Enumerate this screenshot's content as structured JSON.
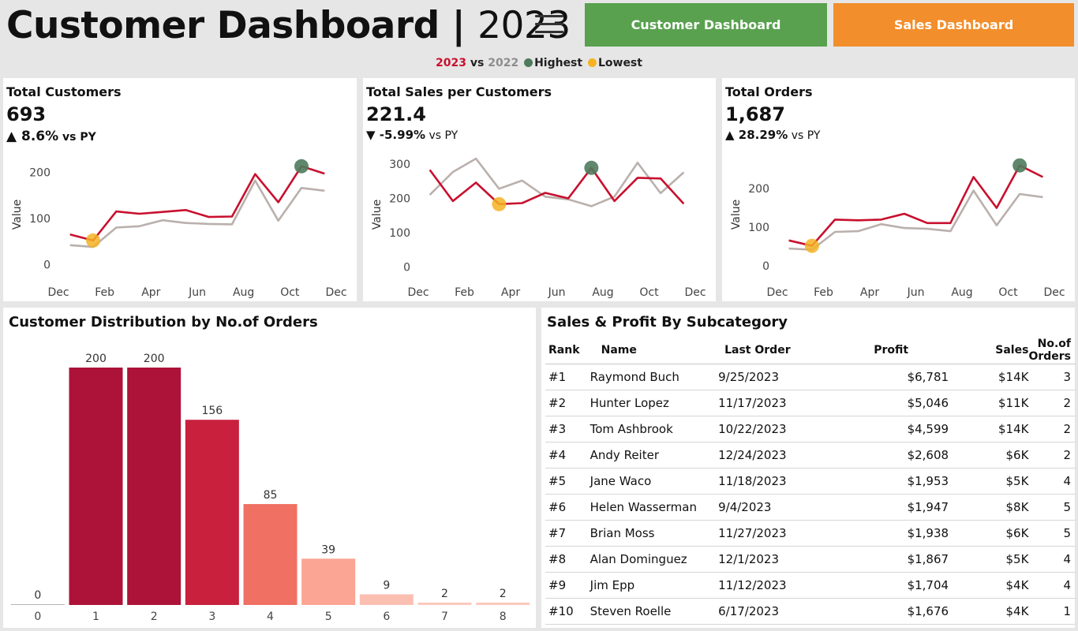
{
  "header": {
    "title_main": "Customer Dashboard | ",
    "title_year": "2023",
    "menu_icon": "hamburger-menu-icon",
    "buttons": [
      {
        "label": "Customer Dashboard",
        "color": "#59a14f"
      },
      {
        "label": "Sales Dashboard",
        "color": "#f28e2b"
      }
    ],
    "legend": {
      "current": "2023",
      "vs": " vs ",
      "previous": "2022",
      "highest_label": "Highest",
      "lowest_label": "Lowest",
      "highest_color": "#4e7b5c",
      "lowest_color": "#f5b324"
    }
  },
  "colors": {
    "current_year": "#c8102e",
    "previous_year": "#bab0ac"
  },
  "kpis": [
    {
      "title": "Total Customers",
      "value": "693",
      "arrow": "▲",
      "change": " 8.6%",
      "vs_label": " vs PY",
      "chart_data": {
        "type": "line",
        "x": [
          "Dec",
          "Jan",
          "Feb",
          "Mar",
          "Apr",
          "May",
          "Jun",
          "Jul",
          "Aug",
          "Sep",
          "Oct",
          "Nov",
          "Dec"
        ],
        "x_ticks": [
          "Dec",
          "Feb",
          "Apr",
          "Jun",
          "Aug",
          "Oct",
          "Dec"
        ],
        "ylabel": "Value",
        "y_ticks": [
          0,
          100,
          200
        ],
        "ylim": [
          -20,
          240
        ],
        "series": [
          {
            "name": "2023",
            "x_start": 0.5,
            "values": [
              65,
              52,
              115,
              110,
              114,
              118,
              103,
              104,
              196,
              135,
              213,
              197
            ]
          },
          {
            "name": "2022",
            "x_start": 0.5,
            "values": [
              42,
              38,
              80,
              83,
              96,
              90,
              88,
              87,
              182,
              95,
              166,
              160
            ]
          }
        ],
        "highest": {
          "index": 10
        },
        "lowest": {
          "index": 1
        }
      }
    },
    {
      "title": "Total Sales per Customers",
      "value": "221.4",
      "arrow": "▼",
      "change": " -5.99%",
      "vs_label": " vs PY",
      "chart_data": {
        "type": "line",
        "x": [
          "Dec",
          "Jan",
          "Feb",
          "Mar",
          "Apr",
          "May",
          "Jun",
          "Jul",
          "Aug",
          "Sep",
          "Oct",
          "Nov",
          "Dec"
        ],
        "x_ticks": [
          "Dec",
          "Feb",
          "Apr",
          "Jun",
          "Aug",
          "Oct",
          "Dec"
        ],
        "ylabel": "Value",
        "y_ticks": [
          0,
          100,
          200,
          300
        ],
        "ylim": [
          -20,
          330
        ],
        "series": [
          {
            "name": "2023",
            "x_start": 0.5,
            "values": [
              283,
              192,
              246,
              183,
              186,
              216,
              200,
              289,
              192,
              260,
              258,
              184
            ]
          },
          {
            "name": "2022",
            "x_start": 0.5,
            "values": [
              210,
              277,
              316,
              228,
              252,
              205,
              197,
              177,
              205,
              304,
              215,
              276
            ]
          }
        ],
        "highest": {
          "index": 7
        },
        "lowest": {
          "index": 3
        }
      }
    },
    {
      "title": "Total Orders",
      "value": "1,687",
      "arrow": "▲",
      "change": " 28.29%",
      "vs_label": " vs PY",
      "chart_data": {
        "type": "line",
        "x": [
          "Dec",
          "Jan",
          "Feb",
          "Mar",
          "Apr",
          "May",
          "Jun",
          "Jul",
          "Aug",
          "Sep",
          "Oct",
          "Nov",
          "Dec"
        ],
        "x_ticks": [
          "Dec",
          "Feb",
          "Apr",
          "Jun",
          "Aug",
          "Oct",
          "Dec"
        ],
        "ylabel": "Value",
        "y_ticks": [
          0,
          100,
          200
        ],
        "ylim": [
          -20,
          290
        ],
        "series": [
          {
            "name": "2023",
            "x_start": 0.5,
            "values": [
              66,
              52,
              120,
              118,
              120,
              135,
              111,
              111,
              230,
              150,
              260,
              230
            ]
          },
          {
            "name": "2022",
            "x_start": 0.5,
            "values": [
              45,
              42,
              88,
              90,
              108,
              98,
              96,
              90,
              195,
              105,
              186,
              178
            ]
          }
        ],
        "highest": {
          "index": 10
        },
        "lowest": {
          "index": 1
        }
      }
    }
  ],
  "distribution": {
    "title": "Customer Distribution by No.of Orders",
    "chart_data": {
      "type": "bar",
      "categories": [
        "0",
        "1",
        "2",
        "3",
        "4",
        "5",
        "6",
        "7",
        "8"
      ],
      "values": [
        0,
        200,
        200,
        156,
        85,
        39,
        9,
        2,
        2
      ],
      "ylim": [
        0,
        200
      ],
      "colors": [
        "#b5b5b5",
        "#ad1238",
        "#ad1238",
        "#c8203d",
        "#f07064",
        "#fba594",
        "#fbbfb2",
        "#fcc9bd",
        "#fcc9bd"
      ]
    }
  },
  "table": {
    "title": "Sales & Profit By Subcategory",
    "columns": [
      "Rank",
      "Name",
      "Last Order",
      "Profit",
      "Sales",
      "No.of Orders"
    ],
    "rows": [
      [
        "#1",
        "Raymond Buch",
        "9/25/2023",
        "$6,781",
        "$14K",
        "3"
      ],
      [
        "#2",
        "Hunter Lopez",
        "11/17/2023",
        "$5,046",
        "$11K",
        "2"
      ],
      [
        "#3",
        "Tom Ashbrook",
        "10/22/2023",
        "$4,599",
        "$14K",
        "2"
      ],
      [
        "#4",
        "Andy Reiter",
        "12/24/2023",
        "$2,608",
        "$6K",
        "2"
      ],
      [
        "#5",
        "Jane Waco",
        "11/18/2023",
        "$1,953",
        "$5K",
        "4"
      ],
      [
        "#6",
        "Helen Wasserman",
        "9/4/2023",
        "$1,947",
        "$8K",
        "5"
      ],
      [
        "#7",
        "Brian Moss",
        "11/27/2023",
        "$1,938",
        "$6K",
        "5"
      ],
      [
        "#8",
        "Alan Dominguez",
        "12/1/2023",
        "$1,867",
        "$5K",
        "4"
      ],
      [
        "#9",
        "Jim Epp",
        "11/12/2023",
        "$1,704",
        "$4K",
        "4"
      ],
      [
        "#10",
        "Steven Roelle",
        "6/17/2023",
        "$1,676",
        "$4K",
        "1"
      ]
    ]
  }
}
